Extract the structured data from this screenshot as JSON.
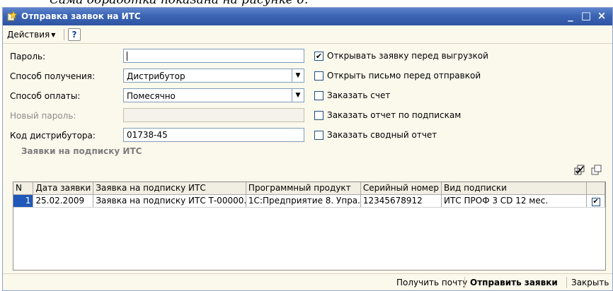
{
  "window": {
    "title": "Отправка заявок на ИТС",
    "minimize": "_",
    "maximize": "□",
    "close": "×"
  },
  "toolbar": {
    "actions_label": "Действия",
    "help_label": "?"
  },
  "form": {
    "password_label": "Пароль:",
    "password_value": "",
    "receive_method_label": "Способ получения:",
    "receive_method_value": "Дистрибутор",
    "payment_method_label": "Способ оплаты:",
    "payment_method_value": "Помесячно",
    "new_password_label": "Новый пароль:",
    "new_password_value": "",
    "distributor_code_label": "Код дистрибутора:",
    "distributor_code_value": "01738-45"
  },
  "options": [
    {
      "label": "Открывать заявку перед выгрузкой",
      "checked": true
    },
    {
      "label": "Открыть письмо перед отправкой",
      "checked": false
    },
    {
      "label": "Заказать счет",
      "checked": false
    },
    {
      "label": "Заказать отчет по подпискам",
      "checked": false
    },
    {
      "label": "Заказать сводный отчет",
      "checked": false
    }
  ],
  "section_title": "Заявки на подписку ИТС",
  "table": {
    "headers": [
      "N",
      "Дата заявки",
      "Заявка на подписку ИТС",
      "Программный продукт",
      "Серийный номер",
      "Вид подписки",
      ""
    ],
    "rows": [
      [
        "1",
        "25.02.2009",
        "Заявка на подписку ИТС Т-00000...",
        "1С:Предприятие 8. Упра...",
        "12345678912",
        "ИТС ПРОФ 3 CD 12 мес.",
        "✔"
      ]
    ]
  },
  "bottom": {
    "get_mail": "Получить почту",
    "send_requests": "Отправить заявки",
    "close": "Закрыть"
  },
  "colors": {
    "titlebar": "#3b64b3",
    "window_bg": "#fbf8ec",
    "selection": "#1f58b8"
  }
}
